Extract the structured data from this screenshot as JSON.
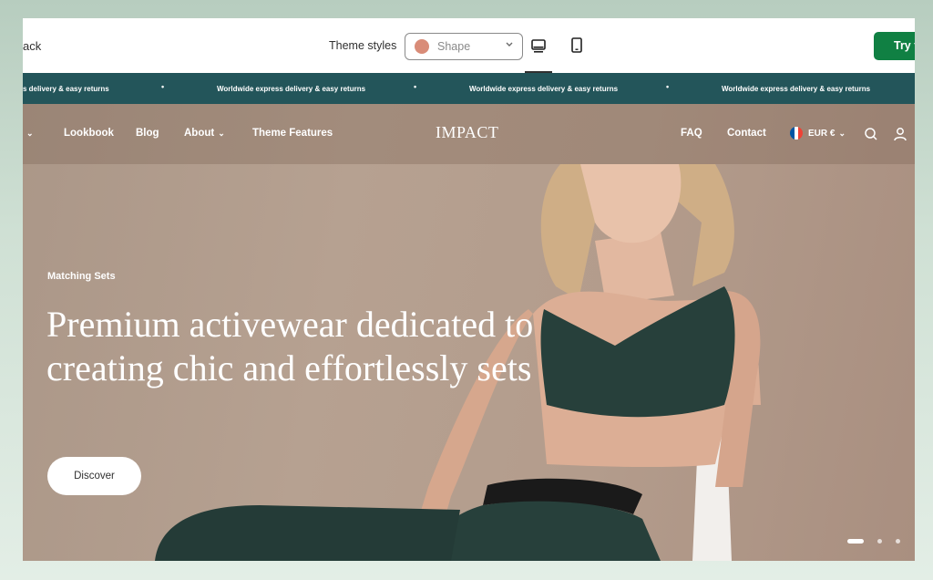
{
  "toolbar": {
    "back_label": "ack",
    "theme_styles_label": "Theme styles",
    "shape_select": {
      "value": "Shape",
      "swatch_color": "#d98c78"
    },
    "devices": [
      "desktop-icon",
      "mobile-icon"
    ],
    "try_label": "Try t"
  },
  "announcement": {
    "items": [
      "s delivery & easy returns",
      "Worldwide express delivery & easy returns",
      "Worldwide express delivery & easy returns",
      "Worldwide express delivery & easy returns"
    ],
    "separator": "•"
  },
  "header": {
    "nav_left": [
      "Lookbook",
      "Blog",
      "About",
      "Theme Features"
    ],
    "logo": "IMPACT",
    "nav_right": [
      "FAQ",
      "Contact"
    ],
    "currency": "EUR €",
    "chevron": "⌄"
  },
  "hero": {
    "eyebrow": "Matching Sets",
    "headline": "Premium activewear dedicated to creating chic and effortlessly sets",
    "button_label": "Discover",
    "slides": 3,
    "active_slide": 1
  },
  "colors": {
    "announcement_bg": "#23555a",
    "try_button": "#108043",
    "hero_bg": "#b6a191",
    "outfit": "#27403b"
  }
}
